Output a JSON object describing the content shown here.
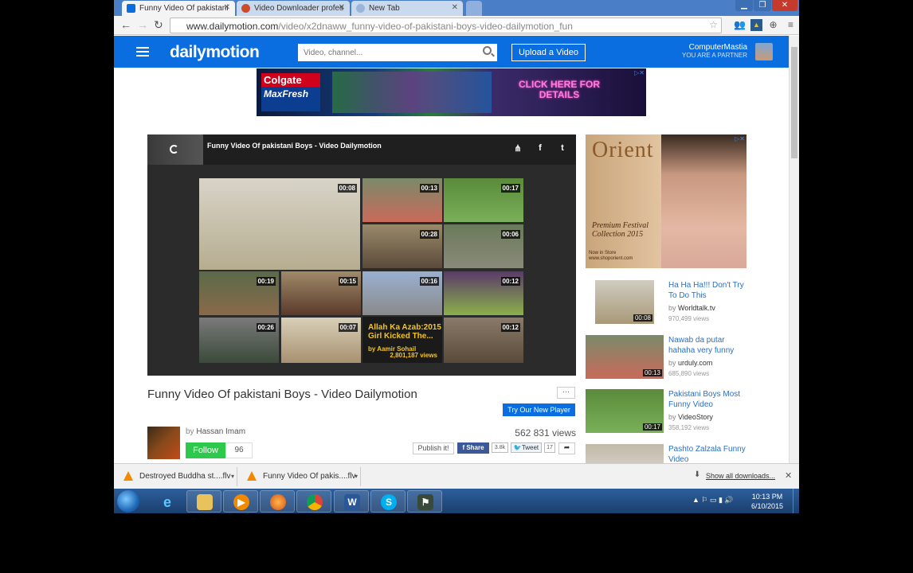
{
  "browser": {
    "tabs": [
      {
        "label": "Funny Video Of pakistani",
        "active": true,
        "favicon_color": "#0b6ee0"
      },
      {
        "label": "Video Downloader profes",
        "active": false,
        "favicon_color": "#d04a2a"
      },
      {
        "label": "New Tab",
        "active": false,
        "favicon_color": "#9bb5d9"
      }
    ],
    "url_host": "www.dailymotion.com",
    "url_path": "/video/x2dnaww_funny-video-of-pakistani-boys-video-dailymotion_fun"
  },
  "header": {
    "logo": "dailymotion",
    "search_placeholder": "Video, channel...",
    "upload_label": "Upload a Video",
    "username": "ComputerMastia",
    "user_status": "YOU ARE A PARTNER"
  },
  "banner_ad": {
    "brand_top": "Colgate",
    "brand_bottom": "MaxFresh",
    "cta": "CLICK HERE FOR DETAILS"
  },
  "player": {
    "title": "Funny Video Of pakistani Boys  - Video Dailymotion",
    "durations": [
      "00:08",
      "00:13",
      "00:17",
      "00:28",
      "00:06",
      "00:19",
      "00:15",
      "00:16",
      "00:12",
      "00:26",
      "00:07",
      "00:12"
    ],
    "promo_title": "Allah Ka Azab:2015 Girl Kicked The...",
    "promo_by": "by Aamir Sohail",
    "promo_views": "2,801,187 views"
  },
  "video": {
    "title": "Funny Video Of pakistani Boys - Video Dailymotion",
    "try_player": "Try Our New Player",
    "channel_by": "by",
    "channel_name": "Hassan Imam",
    "follow_label": "Follow",
    "followers": "96",
    "views": "562 831 views",
    "publish_label": "Publish it!",
    "fb_share": "Share",
    "fb_count": "3.8k",
    "tweet_label": "Tweet",
    "tweet_count": "17"
  },
  "side_ad": {
    "brand": "Orient",
    "line1": "Premium Festival Collection 2015",
    "line2": "Now in Store www.shoporient.com"
  },
  "related": [
    {
      "title": "Ha Ha Ha!!! Don't Try To Do This",
      "by": "by",
      "channel": "Worldtalk.tv",
      "views": "970,499 views",
      "duration": "00:08"
    },
    {
      "title": "Nawab da putar hahaha very funny",
      "by": "by",
      "channel": "urduly.com",
      "views": "685,890 views",
      "duration": "00:13"
    },
    {
      "title": "Pakistani Boys Most Funny Video",
      "by": "by",
      "channel": "VideoStory",
      "views": "358,192 views",
      "duration": "00:17"
    },
    {
      "title": "Pashto Zalzala Funny Video",
      "by": "",
      "channel": "",
      "views": "",
      "duration": ""
    }
  ],
  "downloads": {
    "items": [
      "Destroyed Buddha st....flv",
      "Funny Video Of pakis....flv"
    ],
    "show_all": "Show all downloads..."
  },
  "taskbar": {
    "time": "10:13 PM",
    "date": "6/10/2015"
  }
}
